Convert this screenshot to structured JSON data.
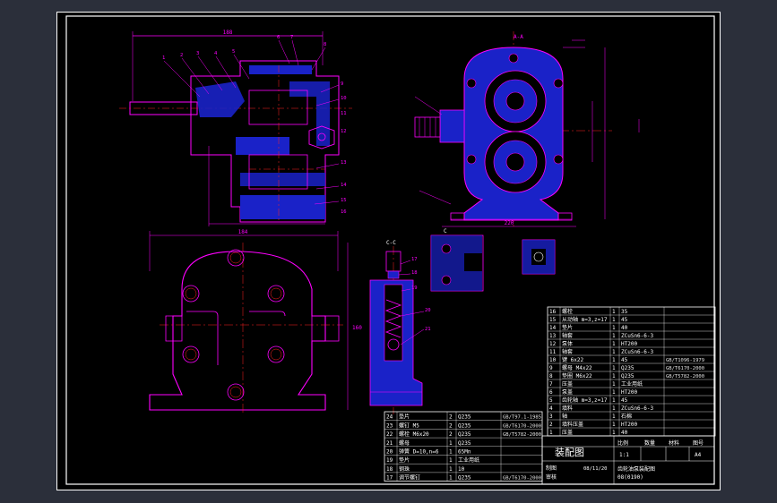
{
  "colors": {
    "background": "#2b2f3a",
    "sheet": "#000000",
    "frame": "#ffffff",
    "outline": "#ff00ff",
    "centerline": "#ff2020",
    "section_fill": "#1a22c8",
    "dimension": "#ff00ff",
    "table_line": "#ffffff"
  },
  "views": {
    "section_a_label": "A-A",
    "section_c_label": "C-C",
    "detail_label": "C",
    "front_width_dim": "188",
    "side_width_dim": "220",
    "bottom_width_dim": "184",
    "side_height_dim": "160",
    "callouts_front": [
      "1",
      "2",
      "3",
      "4",
      "5",
      "6",
      "7",
      "8",
      "9",
      "10",
      "11",
      "12",
      "13",
      "14",
      "15",
      "16"
    ],
    "callouts_valve": [
      "17",
      "18",
      "19",
      "20",
      "21"
    ]
  },
  "bom_upper": {
    "rows": [
      {
        "no": "16",
        "name": "螺栓",
        "qty": "1",
        "material": "35",
        "note": ""
      },
      {
        "no": "15",
        "name": "从动轴 m=3,z=17",
        "qty": "1",
        "material": "45",
        "note": ""
      },
      {
        "no": "14",
        "name": "垫片",
        "qty": "1",
        "material": "40",
        "note": ""
      },
      {
        "no": "13",
        "name": "轴套",
        "qty": "1",
        "material": "ZCuSn6-6-3",
        "note": ""
      },
      {
        "no": "12",
        "name": "泵体",
        "qty": "1",
        "material": "HT200",
        "note": ""
      },
      {
        "no": "11",
        "name": "轴套",
        "qty": "1",
        "material": "ZCuSn6-6-3",
        "note": ""
      },
      {
        "no": "10",
        "name": "键 6x22",
        "qty": "1",
        "material": "45",
        "note": "GB/T1096-1979"
      },
      {
        "no": "9",
        "name": "螺母 M4x22",
        "qty": "1",
        "material": "Q235",
        "note": "GB/T6170-2000"
      },
      {
        "no": "8",
        "name": "垫圈 M6x22",
        "qty": "1",
        "material": "Q235",
        "note": "GB/T5782-2000"
      },
      {
        "no": "7",
        "name": "压盖",
        "qty": "1",
        "material": "工业用纸",
        "note": ""
      },
      {
        "no": "6",
        "name": "泵盖",
        "qty": "1",
        "material": "HT200",
        "note": ""
      },
      {
        "no": "5",
        "name": "齿轮轴 m=3,z=17",
        "qty": "1",
        "material": "45",
        "note": ""
      },
      {
        "no": "4",
        "name": "填料",
        "qty": "1",
        "material": "ZCuSn6-6-3",
        "note": ""
      },
      {
        "no": "3",
        "name": "轴",
        "qty": "1",
        "material": "石棉",
        "note": ""
      },
      {
        "no": "2",
        "name": "填料压盖",
        "qty": "1",
        "material": "HT200",
        "note": ""
      },
      {
        "no": "1",
        "name": "压盖",
        "qty": "1",
        "material": "40",
        "note": ""
      }
    ],
    "header": {
      "no": "序号",
      "name": "名称",
      "qty": "数量",
      "material": "材料",
      "note": "备注"
    }
  },
  "bom_lower": {
    "rows": [
      {
        "no": "24",
        "name": "垫片",
        "qty": "2",
        "material": "Q235",
        "note": "GB/T97.1-1985"
      },
      {
        "no": "23",
        "name": "螺钉 M5",
        "qty": "2",
        "material": "Q235",
        "note": "GB/T6170-2000"
      },
      {
        "no": "22",
        "name": "螺栓 M6x20",
        "qty": "2",
        "material": "Q235",
        "note": "GB/T5782-2000"
      },
      {
        "no": "21",
        "name": "螺母",
        "qty": "1",
        "material": "Q235",
        "note": ""
      },
      {
        "no": "20",
        "name": "弹簧 D=10,n=6",
        "qty": "1",
        "material": "65Mn",
        "note": ""
      },
      {
        "no": "19",
        "name": "垫片",
        "qty": "1",
        "material": "工业用纸",
        "note": ""
      },
      {
        "no": "18",
        "name": "钢珠",
        "qty": "1",
        "material": "10",
        "note": ""
      },
      {
        "no": "17",
        "name": "调节螺钉",
        "qty": "1",
        "material": "Q235",
        "note": "GB/T6170-2000"
      }
    ]
  },
  "title_block": {
    "title": "装配图",
    "scale_label": "比例",
    "qty_label": "数量",
    "material_label": "材料",
    "drawing_no_label": "图号",
    "scale_value": "1:1",
    "sheet_size": "A4",
    "drawn_by_label": "制图",
    "checked_by_label": "审核",
    "date": "08/11/20",
    "school": "齿轮油泵装配图",
    "school_code": "08(0190)"
  }
}
